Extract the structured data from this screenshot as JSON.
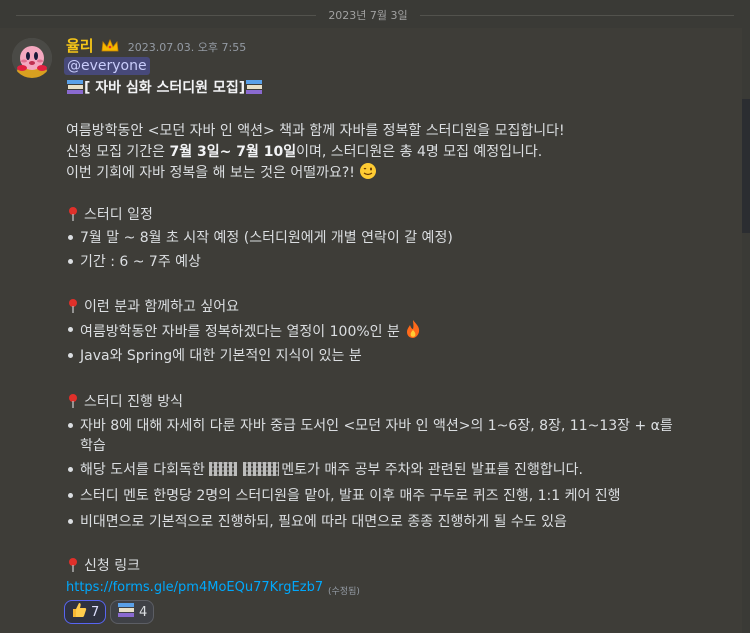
{
  "divider": {
    "date": "2023년 7월 3일"
  },
  "author": {
    "name": "율리",
    "crown_icon": "crown-emoji",
    "timestamp": "2023.07.03. 오후 7:55"
  },
  "message": {
    "mention": "@everyone",
    "title": "[ 자바 심화 스터디원 모집]",
    "intro": [
      "여름방학동안 <모던 자바 인 액션> 책과 함께 자바를 정복할 스터디원을 모집합니다!",
      "이번 기회에 자바 정복을 해 보는 것은 어떨까요?!"
    ],
    "period_prefix": "신청 모집 기간은 ",
    "period_bold": "7월 3일~ 7월 10일",
    "period_suffix": "이며, 스터디원은 총 4명 모집 예정입니다.",
    "sections": [
      {
        "heading": "스터디 일정",
        "items": [
          "7월 말 ~ 8월 초 시작 예정 (스터디원에게 개별 연락이 갈 예정)",
          "기간 : 6 ~ 7주 예상"
        ]
      },
      {
        "heading": "이런 분과 함께하고 싶어요",
        "items": [
          "여름방학동안 자바를 정복하겠다는 열정이 100%인 분",
          "Java와 Spring에 대한 기본적인 지식이 있는 분"
        ]
      },
      {
        "heading": "스터디 진행 방식",
        "items": [
          "자바 8에 대해 자세히 다룬 자바 중급 도서인 <모던 자바 인 액션>의 1~6장, 8장, 11~13장 + α를",
          "학습",
          "해당 도서를 다회독한",
          "멘토가 매주 공부 주차와 관련된 발표를 진행합니다.",
          "스터디 멘토 한명당 2명의 스터디원을 맡아, 발표 이후 매주 구두로 퀴즈 진행, 1:1 케어 진행",
          "비대면으로 기본적으로 진행하되, 필요에 따라 대면으로 종종 진행하게 될 수도 있음"
        ]
      },
      {
        "heading": "신청 링크"
      }
    ],
    "link": "https://forms.gle/pm4MoEQu77KrgEzb7",
    "edited": "(수정됨)"
  },
  "reactions": [
    {
      "icon": "thumbs-up-emoji",
      "count": "7"
    },
    {
      "icon": "books-emoji",
      "count": "4"
    }
  ],
  "colors": {
    "background": "#3a3a36",
    "username": "#f5c518",
    "link": "#00a8fc",
    "mention_bg": "#47497a"
  }
}
